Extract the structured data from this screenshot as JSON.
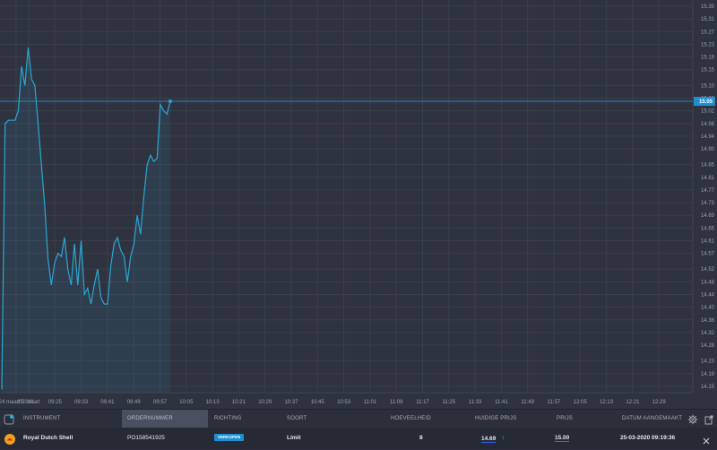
{
  "chart_data": {
    "type": "line",
    "x_tick_labels": [
      "24 maart 2020",
      "25. maart",
      "09:25",
      "09:33",
      "09:41",
      "09:49",
      "09:57",
      "10:05",
      "10:13",
      "10:21",
      "10:29",
      "10:37",
      "10:45",
      "10:53",
      "11:01",
      "11:09",
      "11:17",
      "11:25",
      "11:33",
      "11:41",
      "11:49",
      "11:57",
      "12:05",
      "12:13",
      "12:21",
      "12:29"
    ],
    "y_tick_labels": [
      "15.35",
      "15.31",
      "15.27",
      "15.23",
      "15.19",
      "15.15",
      "15.10",
      "15.06",
      "15.02",
      "14.98",
      "14.94",
      "14.90",
      "14.85",
      "14.81",
      "14.77",
      "14.73",
      "14.69",
      "14.65",
      "14.61",
      "14.57",
      "14.52",
      "14.48",
      "14.44",
      "14.40",
      "14.36",
      "14.32",
      "14.28",
      "14.23",
      "14.19",
      "14.15"
    ],
    "ylim": [
      14.13,
      15.37
    ],
    "current_price_label": "15.05",
    "current_price": 15.05,
    "series": [
      {
        "values": [
          14.14,
          14.98,
          14.99,
          14.99,
          14.99,
          15.02,
          15.16,
          15.1,
          15.22,
          15.12,
          15.1,
          14.98,
          14.85,
          14.72,
          14.55,
          14.47,
          14.54,
          14.57,
          14.56,
          14.62,
          14.52,
          14.47,
          14.6,
          14.47,
          14.61,
          14.44,
          14.46,
          14.41,
          14.47,
          14.52,
          14.43,
          14.41,
          14.41,
          14.53,
          14.6,
          14.62,
          14.58,
          14.56,
          14.48,
          14.56,
          14.6,
          14.69,
          14.63,
          14.75,
          14.85,
          14.88,
          14.86,
          14.87,
          15.04,
          15.02,
          15.01,
          15.05
        ]
      }
    ]
  },
  "table": {
    "settings_icon": "gear-icon",
    "export_icon": "export-icon",
    "columns": [
      {
        "label": "INSTRUMENT"
      },
      {
        "label": "ORDERNUMMER"
      },
      {
        "label": "RICHTING"
      },
      {
        "label": "SOORT"
      },
      {
        "label": "HOEVEELHEID"
      },
      {
        "label": "HUIDIGE PRIJS"
      },
      {
        "label": "PRIJS"
      },
      {
        "label": "DATUM AANGEMAAKT"
      }
    ],
    "row": {
      "instrument": "Royal Dutch Shell",
      "ordernummer": "PO158541925",
      "richting": "VERKOPEN",
      "soort": "Limit",
      "hoeveelheid": "8",
      "huidige_prijs": "14.69",
      "prijs": "15.00",
      "datum": "25-03-2020 09:19:36"
    },
    "colors": {
      "accent": "#1f8fd1",
      "line": "#2aa7d3",
      "up_arrow": "#4caf50"
    }
  }
}
